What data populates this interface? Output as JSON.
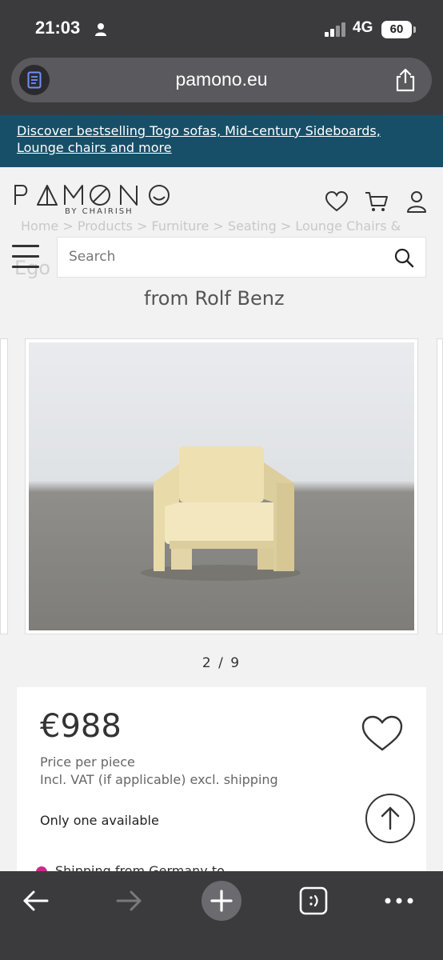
{
  "status": {
    "time": "21:03",
    "network": "4G",
    "battery": "60"
  },
  "browser": {
    "url": "pamono.eu"
  },
  "promo": {
    "text": "Discover bestselling Togo sofas, Mid-century Sideboards, Lounge chairs and more"
  },
  "header": {
    "logo": "PAMONO",
    "logo_sub": "BY CHAIRISH",
    "breadcrumb_ghost": "Home > Products > Furniture > Seating > Lounge Chairs &",
    "title_ghost_line1": "Ego",
    "title_ghost_line2": "from Rolf Benz"
  },
  "search": {
    "placeholder": "Search"
  },
  "gallery": {
    "counter": "2 / 9",
    "chair_color": "#efe3b6"
  },
  "product": {
    "price": "€988",
    "price_note": "Price per piece",
    "tax_note": "Incl. VAT (if applicable) excl. shipping",
    "availability": "Only one available",
    "shipping": "Shipping from Germany to"
  },
  "colors": {
    "promo_bg": "#174f68",
    "chrome_bg": "#3b3b3d",
    "shipping_pin": "#d0268f"
  },
  "icons": [
    "person-icon",
    "reader-icon",
    "share-icon",
    "heart-icon",
    "cart-icon",
    "account-icon",
    "menu-icon",
    "search-icon",
    "arrow-up-icon",
    "back-arrow-icon",
    "forward-arrow-icon",
    "new-tab-icon",
    "tabs-icon",
    "more-icon"
  ]
}
